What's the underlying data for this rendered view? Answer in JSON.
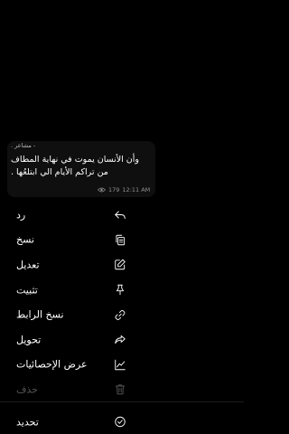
{
  "message": {
    "author": "- مشاعر .",
    "lines": [
      "وأن الأنسان يموت في نهاية المطاف",
      "من تراكم الأيام الي ابتلعُها .",
      ""
    ],
    "views": "179",
    "time": "12:11 AM"
  },
  "menu": {
    "items": [
      {
        "label": "رد",
        "icon": "reply-icon"
      },
      {
        "label": "نسخ",
        "icon": "copy-icon"
      },
      {
        "label": "تعديل",
        "icon": "edit-icon"
      },
      {
        "label": "تثبيت",
        "icon": "pin-icon"
      },
      {
        "label": "نسخ الرابط",
        "icon": "link-icon"
      },
      {
        "label": "تحويل",
        "icon": "forward-icon"
      },
      {
        "label": "عرض الإحصائيات",
        "icon": "stats-icon"
      },
      {
        "label": "حذف",
        "icon": "trash-icon",
        "disabled": true
      },
      {
        "label": "تحديد",
        "icon": "select-check-icon"
      }
    ]
  },
  "colors": {
    "background": "#000000",
    "bubble": "#0f0f10",
    "text": "#ffffff",
    "muted": "#8f8f8f",
    "disabled": "#555555"
  }
}
